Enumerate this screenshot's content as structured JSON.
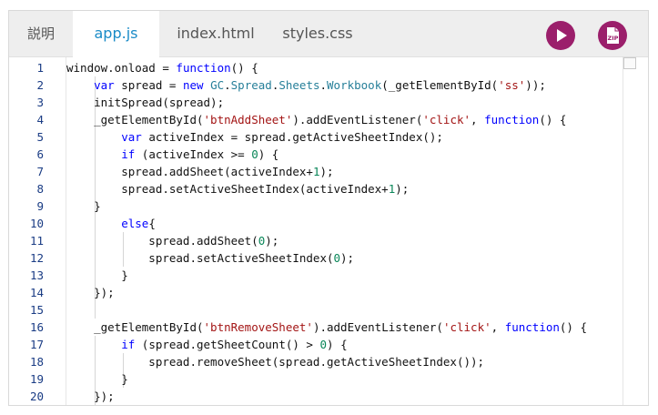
{
  "tabs": [
    {
      "label": "説明",
      "active": false
    },
    {
      "label": "app.js",
      "active": true
    },
    {
      "label": "index.html",
      "active": false
    },
    {
      "label": "styles.css",
      "active": false
    }
  ],
  "toolbar": {
    "run_icon": "play-icon",
    "zip_icon": "zip-download-icon",
    "zip_label": "ZIP",
    "accent_color": "#9b1f6b"
  },
  "colors": {
    "active_tab_text": "#1a8bc7",
    "keyword": "#0000ff",
    "string": "#a31515",
    "number": "#098658",
    "line_number": "#1a3c84"
  },
  "code": {
    "line_numbers": [
      "1",
      "2",
      "3",
      "4",
      "5",
      "6",
      "7",
      "8",
      "9",
      "10",
      "11",
      "12",
      "13",
      "14",
      "15",
      "16",
      "17",
      "18",
      "19",
      "20"
    ],
    "lines": [
      "window.onload = function() {",
      "    var spread = new GC.Spread.Sheets.Workbook(_getElementById('ss'));",
      "    initSpread(spread);",
      "    _getElementById('btnAddSheet').addEventListener('click', function() {",
      "        var activeIndex = spread.getActiveSheetIndex();",
      "        if (activeIndex >= 0) {",
      "        spread.addSheet(activeIndex+1);",
      "        spread.setActiveSheetIndex(activeIndex+1);",
      "    }",
      "        else{",
      "            spread.addSheet(0);",
      "            spread.setActiveSheetIndex(0);",
      "        }",
      "    });",
      "",
      "    _getElementById('btnRemoveSheet').addEventListener('click', function() {",
      "        if (spread.getSheetCount() > 0) {",
      "            spread.removeSheet(spread.getActiveSheetIndex());",
      "        }",
      "    });"
    ]
  }
}
